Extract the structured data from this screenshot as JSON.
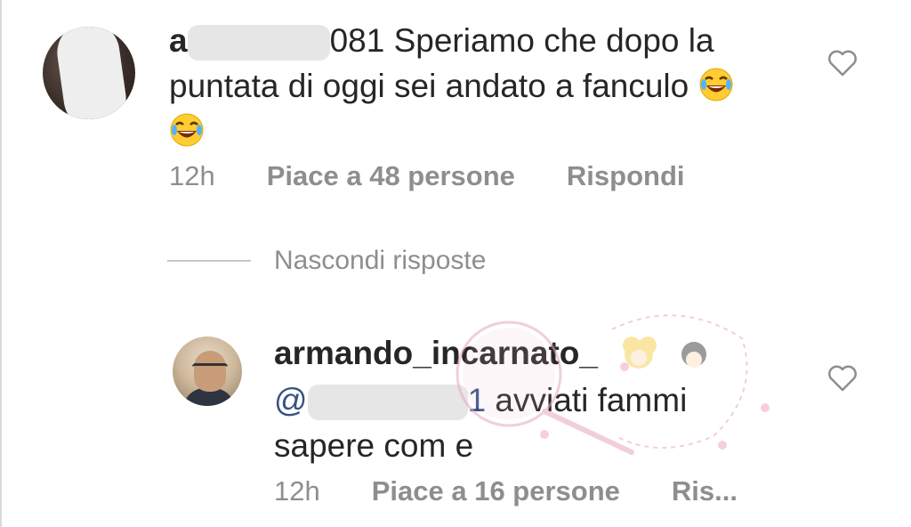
{
  "comments": [
    {
      "username_visible_start": "a",
      "username_visible_end": "081",
      "text_line1": "Speriamo che dopo la",
      "text_line2": "puntata di oggi sei andato a fanculo",
      "emoji": "face-with-tears-of-joy",
      "time": "12h",
      "likes": "Piace a 48 persone",
      "reply": "Rispondi"
    },
    {
      "username": "armando_incarnato_",
      "mention_start": "@",
      "mention_end": "1",
      "text_line1": "avviati fammi",
      "text_line2": "sapere com e",
      "time": "12h",
      "likes": "Piace a 16 persone",
      "reply": "Ris..."
    }
  ],
  "hide_replies": "Nascondi risposte",
  "icons": {
    "like": "heart-outline-icon"
  },
  "colors": {
    "text": "#262626",
    "meta": "#8e8e8e",
    "mention": "#385185"
  }
}
